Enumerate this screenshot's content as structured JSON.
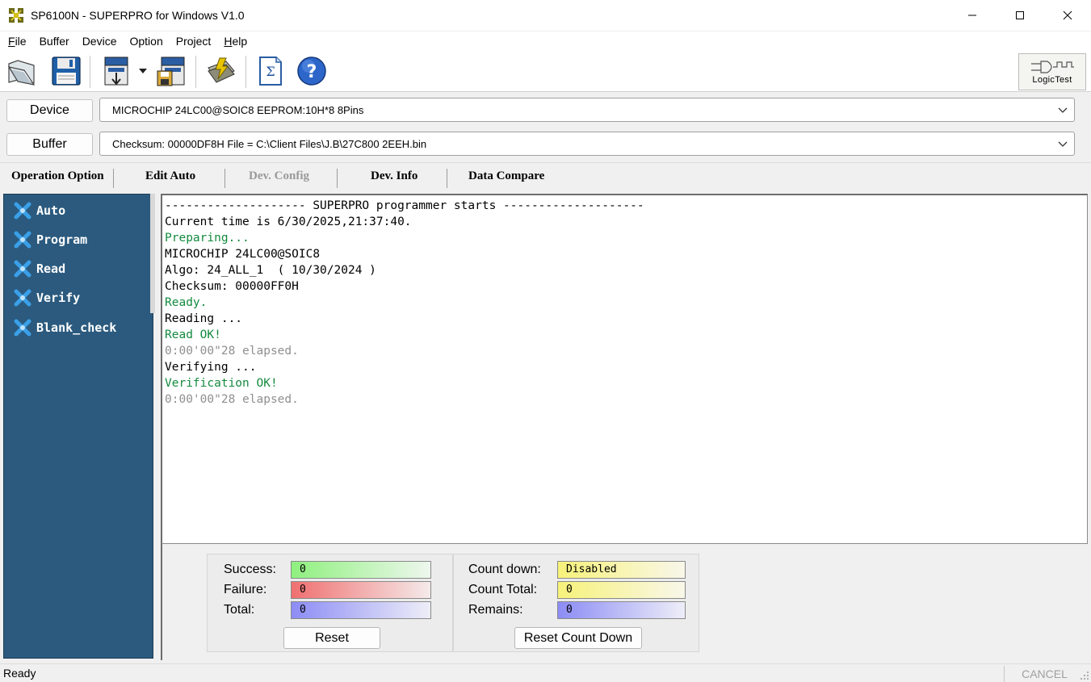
{
  "window": {
    "title": "SP6100N - SUPERPRO for Windows V1.0",
    "minimize": "—",
    "maximize": "☐",
    "close": "✕"
  },
  "menu": {
    "items": [
      {
        "label": "File",
        "accel": "F",
        "rest": "ile"
      },
      {
        "label": "Buffer",
        "accel": "",
        "rest": "Buffer"
      },
      {
        "label": "Device",
        "accel": "",
        "rest": "Device"
      },
      {
        "label": "Option",
        "accel": "",
        "rest": "Option"
      },
      {
        "label": "Project",
        "accel": "",
        "rest": "Project"
      },
      {
        "label": "Help",
        "accel": "H",
        "rest": "elp"
      }
    ]
  },
  "toolbar": {
    "icons": [
      "open-folder-icon",
      "save-disk-icon",
      "load-project-icon",
      "dropdown-arrow-icon",
      "save-project-icon",
      "auto-tool-icon",
      "checksum-icon",
      "help-icon"
    ],
    "logictest_label": "LogicTest"
  },
  "device": {
    "button_label": "Device",
    "value": "MICROCHIP  24LC00@SOIC8  EEPROM:10H*8  8Pins"
  },
  "buffer": {
    "button_label": "Buffer",
    "value": "Checksum: 00000DF8H    File = C:\\Client Files\\J.B\\27C800 2EEH.bin"
  },
  "option_tabs": [
    {
      "label": "Operation Option",
      "enabled": true
    },
    {
      "label": "Edit Auto",
      "enabled": true
    },
    {
      "label": "Dev. Config",
      "enabled": false
    },
    {
      "label": "Dev. Info",
      "enabled": true
    },
    {
      "label": "Data Compare",
      "enabled": true
    }
  ],
  "operations": [
    {
      "label": "Auto"
    },
    {
      "label": "Program"
    },
    {
      "label": "Read"
    },
    {
      "label": "Verify"
    },
    {
      "label": "Blank_check"
    }
  ],
  "log": [
    {
      "text": "-------------------- SUPERPRO programmer starts --------------------",
      "style": "default"
    },
    {
      "text": "Current time is 6/30/2025,21:37:40.",
      "style": "default"
    },
    {
      "text": "Preparing...",
      "style": "green"
    },
    {
      "text": "MICROCHIP 24LC00@SOIC8",
      "style": "default"
    },
    {
      "text": "Algo: 24_ALL_1  ( 10/30/2024 )",
      "style": "default"
    },
    {
      "text": "Checksum: 00000FF0H",
      "style": "default"
    },
    {
      "text": "Ready.",
      "style": "green"
    },
    {
      "text": "Reading ...",
      "style": "default"
    },
    {
      "text": "Read OK!",
      "style": "green"
    },
    {
      "text": "0:00'00\"28 elapsed.",
      "style": "gray"
    },
    {
      "text": "Verifying ...",
      "style": "default"
    },
    {
      "text": "Verification OK!",
      "style": "green"
    },
    {
      "text": "0:00'00\"28 elapsed.",
      "style": "gray"
    }
  ],
  "counters": {
    "success_label": "Success:",
    "success_value": "0",
    "failure_label": "Failure:",
    "failure_value": "0",
    "total_label": "Total:",
    "total_value": "0",
    "reset_label": "Reset",
    "countdown_label": "Count down:",
    "countdown_value": "Disabled",
    "count_total_label": "Count Total:",
    "count_total_value": "0",
    "remains_label": "Remains:",
    "remains_value": "0",
    "reset_countdown_label": "Reset Count Down"
  },
  "status": {
    "text": "Ready",
    "cancel_label": "CANCEL"
  },
  "colors": {
    "left_panel": "#2b5a7e",
    "log_green": "#138a3e",
    "log_gray": "#8f8f8f"
  }
}
